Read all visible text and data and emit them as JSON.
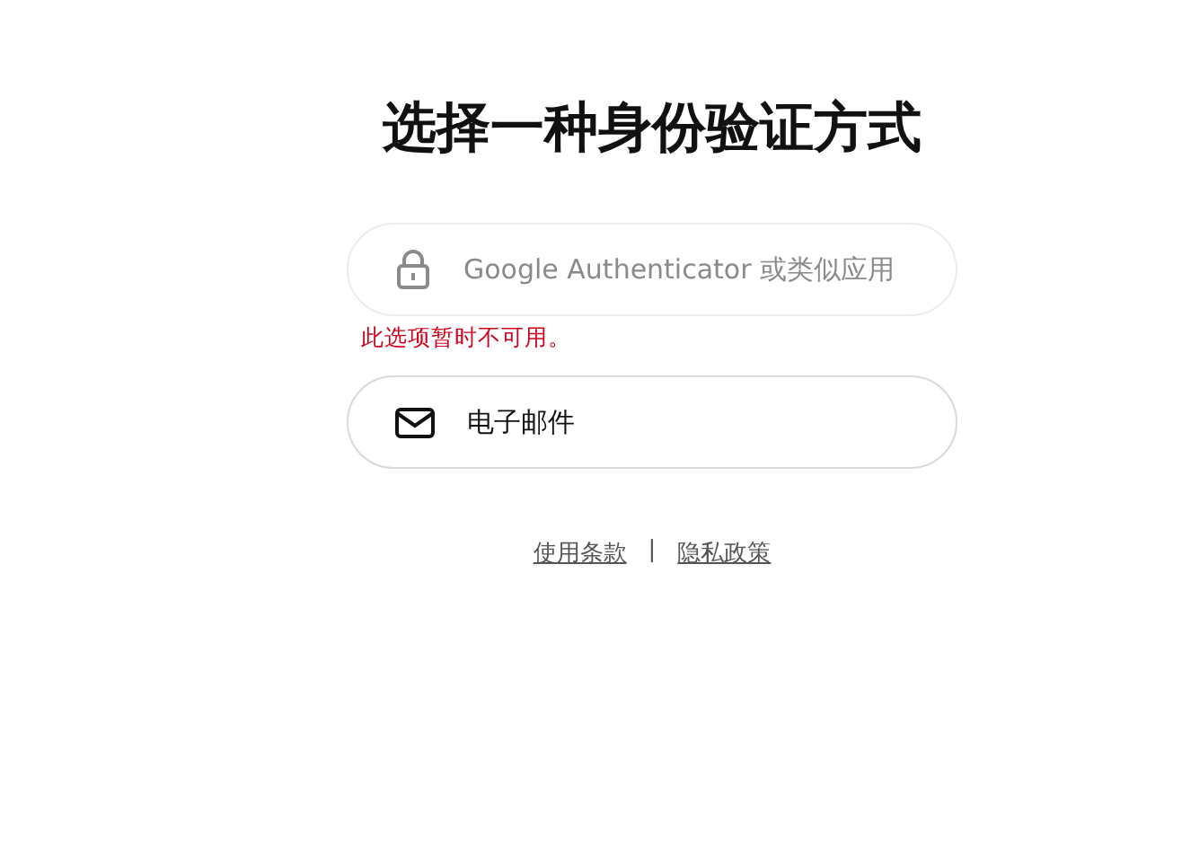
{
  "title": "选择一种身份验证方式",
  "options": [
    {
      "kind": "lock",
      "label": "Google Authenticator 或类似应用",
      "disabled": true,
      "error": "此选项暂时不可用。"
    },
    {
      "kind": "mail",
      "label": "电子邮件",
      "disabled": false
    }
  ],
  "footer_links": [
    {
      "label": "使用条款"
    },
    {
      "label": "隐私政策"
    }
  ],
  "separator": "|"
}
